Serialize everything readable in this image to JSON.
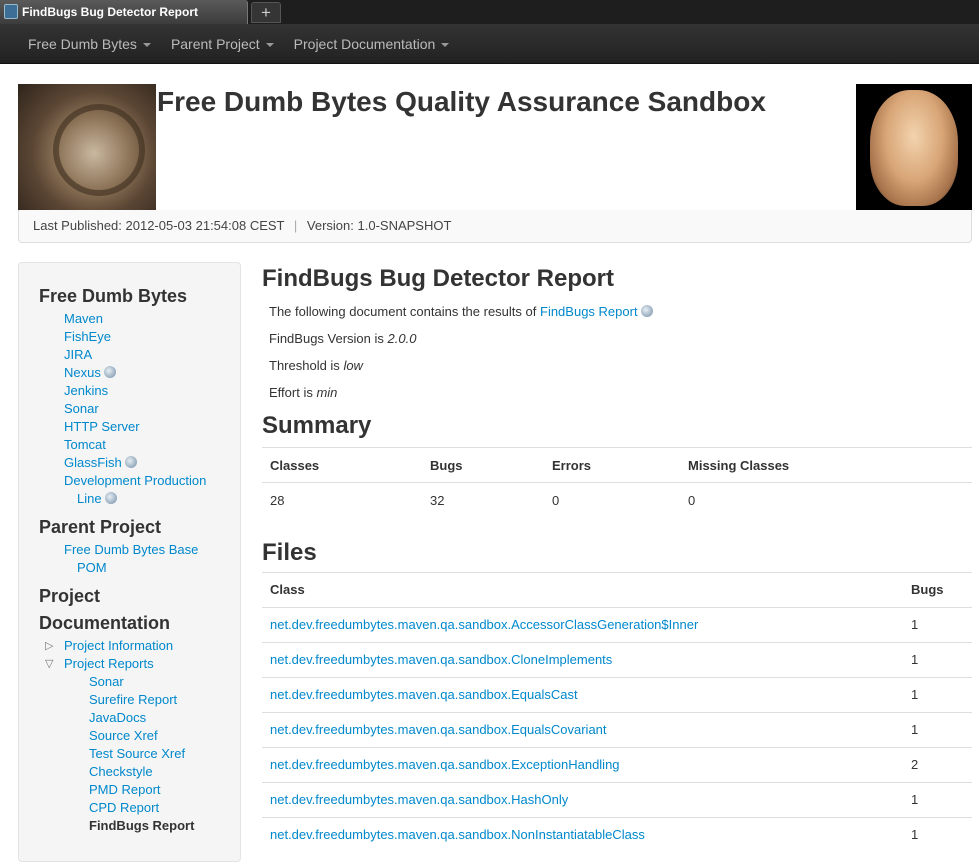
{
  "browser": {
    "tab_title": "FindBugs Bug Detector Report",
    "new_tab": "+"
  },
  "navbar": {
    "items": [
      "Free Dumb Bytes",
      "Parent Project",
      "Project Documentation"
    ]
  },
  "header": {
    "site_title": "Free Dumb Bytes Quality Assurance Sandbox",
    "published": "Last Published: 2012-05-03 21:54:08 CEST",
    "divider": "|",
    "version": "Version: 1.0-SNAPSHOT"
  },
  "sidebar": {
    "section1": {
      "title": "Free Dumb Bytes",
      "items": [
        "Maven",
        "FishEye",
        "JIRA",
        "Nexus",
        "Jenkins",
        "Sonar",
        "HTTP Server",
        "Tomcat",
        "GlassFish",
        "Development Production",
        "Line"
      ]
    },
    "section2": {
      "title": "Parent Project",
      "items": [
        "Free Dumb Bytes Base",
        "POM"
      ]
    },
    "section3": {
      "title_line1": "Project",
      "title_line2": "Documentation",
      "items": [
        "Project Information",
        "Project Reports"
      ],
      "subitems": [
        "Sonar",
        "Surefire Report",
        "JavaDocs",
        "Source Xref",
        "Test Source Xref",
        "Checkstyle",
        "PMD Report",
        "CPD Report",
        "FindBugs Report"
      ]
    }
  },
  "main": {
    "title": "FindBugs Bug Detector Report",
    "intro": "The following document contains the results of",
    "intro_link": "FindBugs Report",
    "version_label": "FindBugs Version is",
    "version_value": "2.0.0",
    "threshold_label": "Threshold is",
    "threshold_value": "low",
    "effort_label": "Effort is",
    "effort_value": "min",
    "summary": {
      "title": "Summary",
      "headers": [
        "Classes",
        "Bugs",
        "Errors",
        "Missing Classes"
      ],
      "values": [
        "28",
        "32",
        "0",
        "0"
      ]
    },
    "files": {
      "title": "Files",
      "headers": [
        "Class",
        "Bugs"
      ],
      "rows": [
        [
          "net.dev.freedumbytes.maven.qa.sandbox.AccessorClassGeneration$Inner",
          "1"
        ],
        [
          "net.dev.freedumbytes.maven.qa.sandbox.CloneImplements",
          "1"
        ],
        [
          "net.dev.freedumbytes.maven.qa.sandbox.EqualsCast",
          "1"
        ],
        [
          "net.dev.freedumbytes.maven.qa.sandbox.EqualsCovariant",
          "1"
        ],
        [
          "net.dev.freedumbytes.maven.qa.sandbox.ExceptionHandling",
          "2"
        ],
        [
          "net.dev.freedumbytes.maven.qa.sandbox.HashOnly",
          "1"
        ],
        [
          "net.dev.freedumbytes.maven.qa.sandbox.NonInstantiatableClass",
          "1"
        ]
      ]
    }
  }
}
